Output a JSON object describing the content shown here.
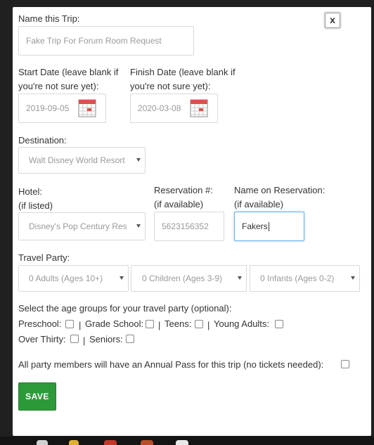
{
  "form": {
    "trip_name_label": "Name this Trip:",
    "trip_name_placeholder": "Fake Trip For Forum Room Request",
    "start_label_1": "Start Date (leave blank if",
    "start_label_2": "you're not sure yet):",
    "start_value": "2019-09-05",
    "finish_label_1": "Finish Date (leave blank if",
    "finish_label_2": "you're not sure yet):",
    "finish_value": "2020-03-08",
    "destination_label": "Destination:",
    "destination_value": "Walt Disney World Resort",
    "hotel_label_1": "Hotel:",
    "hotel_label_2": "(if listed)",
    "hotel_value": "Disney's Pop Century Res",
    "reservation_label_1": "Reservation #:",
    "reservation_label_2": "(if available)",
    "reservation_value": "5623156352",
    "name_res_label_1": "Name on Reservation:",
    "name_res_label_2": "(if available)",
    "name_res_value": "Fakers",
    "party_label": "Travel Party:",
    "adults_value": "0 Adults (Ages 10+)",
    "children_value": "0 Children (Ages 3-9)",
    "infants_value": "0 Infants (Ages 0-2)",
    "age_groups_label": "Select the age groups for your travel party (optional):",
    "age_groups": {
      "preschool": "Preschool:",
      "sep": "|",
      "grade_school": "Grade School:",
      "teens": "Teens:",
      "young_adults": "Young Adults:",
      "over_thirty": "Over Thirty:",
      "seniors": "Seniors:"
    },
    "annual_pass_label": "All party members will have an Annual Pass for this trip (no tickets needed):",
    "save_label": "SAVE",
    "close_label": "x"
  },
  "colors": {
    "save_green": "#2d9a39",
    "focus_blue": "#66afe9",
    "calendar_red": "#d9534f"
  },
  "icons": [
    "calendar-icon",
    "close-icon",
    "chevron-down-icon"
  ]
}
